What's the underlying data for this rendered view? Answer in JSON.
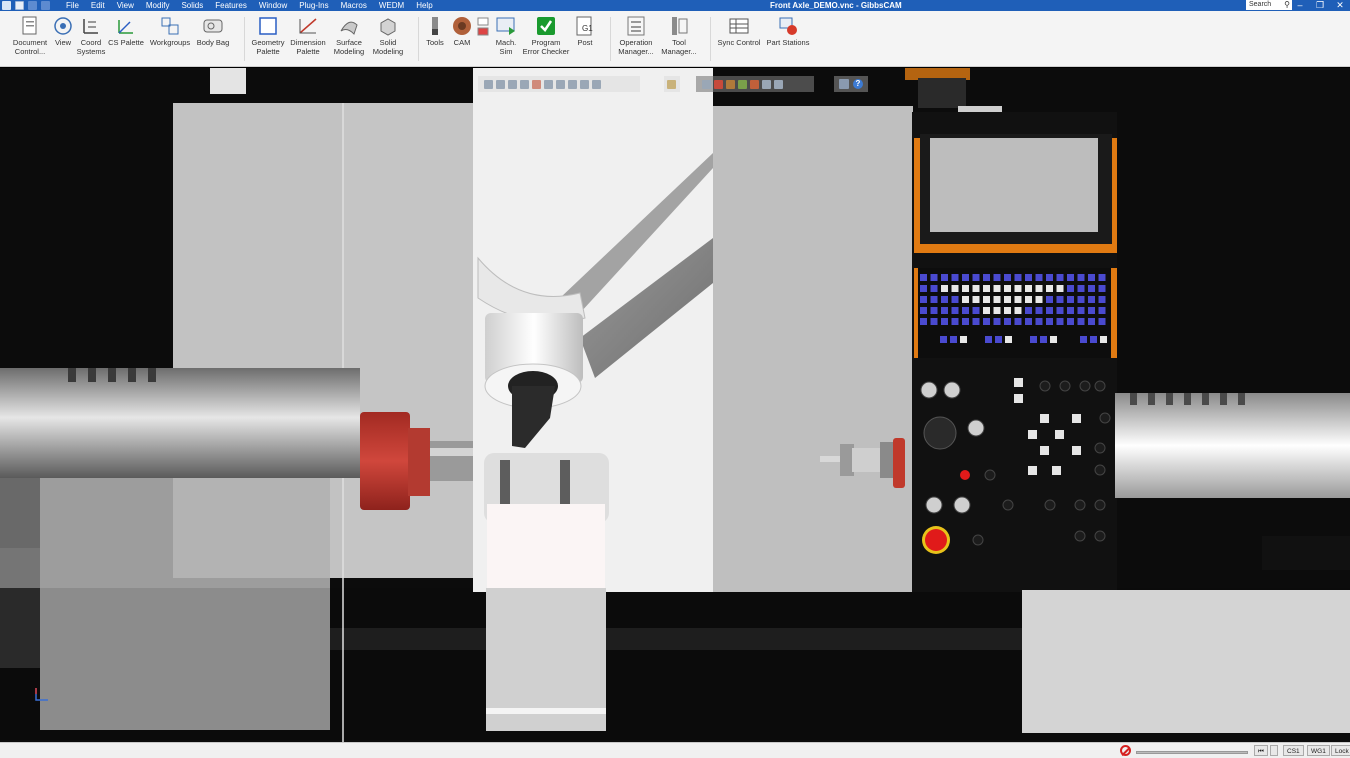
{
  "window": {
    "title": "Front Axle_DEMO.vnc - GibbsCAM",
    "search_placeholder": "Search"
  },
  "menu": [
    "File",
    "Edit",
    "View",
    "Modify",
    "Solids",
    "Features",
    "Window",
    "Plug-Ins",
    "Macros",
    "WEDM",
    "Help"
  ],
  "ribbon": {
    "document_control": "Document\nControl...",
    "view": "View",
    "coord_systems": "Coord\nSystems",
    "cs_palette": "CS Palette",
    "workgroups": "Workgroups",
    "body_bag": "Body Bag",
    "geometry_palette": "Geometry\nPalette",
    "dimension_palette": "Dimension\nPalette",
    "surface_modeling": "Surface\nModeling",
    "solid_modeling": "Solid\nModeling",
    "tools": "Tools",
    "cam": "CAM",
    "mach_sim": "Mach.\nSim",
    "program_error_checker": "Program\nError Checker",
    "post": "Post",
    "operation_manager": "Operation\nManager...",
    "tool_manager": "Tool\nManager...",
    "sync_control": "Sync Control",
    "part_stations": "Part Stations"
  },
  "statusbar": {
    "cs": "CS1",
    "wg": "WG1",
    "lock": "Lock"
  },
  "icons": {
    "app": "gibbscam-logo-icon",
    "save": "save-icon",
    "undo": "undo-icon",
    "redo": "redo-icon",
    "search": "search-icon",
    "minimize": "minimize-icon",
    "restore": "restore-icon",
    "close": "close-icon",
    "help": "help-icon",
    "no_entry": "stop-icon"
  },
  "colors": {
    "titlebar": "#1f5fb8",
    "accent_orange": "#e07a12",
    "chuck_red": "#b8322a",
    "estop_red": "#e01a1a",
    "keypad_blue": "#4a4ad0"
  }
}
